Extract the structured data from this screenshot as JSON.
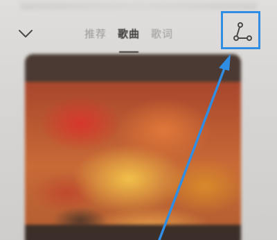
{
  "tabs": [
    {
      "label": "推荐",
      "active": false
    },
    {
      "label": "歌曲",
      "active": true
    },
    {
      "label": "歌词",
      "active": false
    }
  ],
  "icons": {
    "collapse": "chevron-down-icon",
    "share": "share-icon"
  },
  "colors": {
    "highlight": "#2f8de4",
    "active_tab": "#3a3836",
    "inactive_tab": "#9a9896"
  }
}
